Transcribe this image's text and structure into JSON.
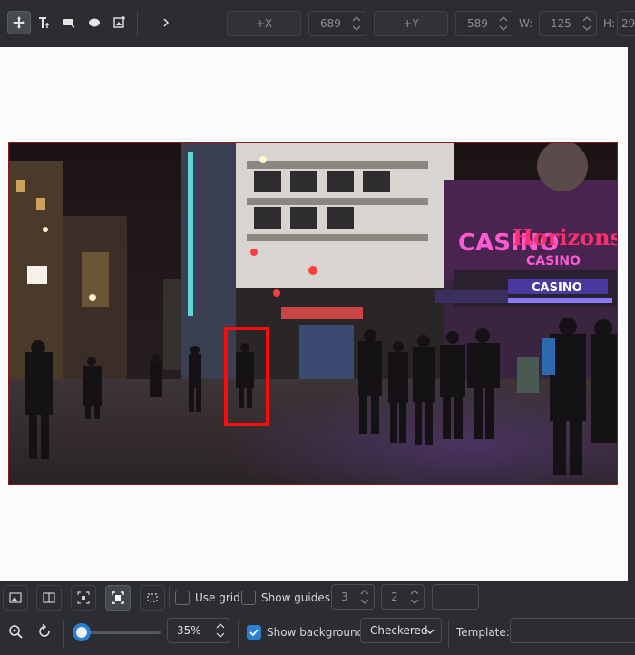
{
  "toolbar": {
    "tools": [
      "move-tool",
      "text-tool",
      "rect-tool",
      "ellipse-tool",
      "image-tool"
    ],
    "more_label": "›",
    "x_button": "+X",
    "x_value": "689",
    "y_button": "+Y",
    "y_value": "589",
    "w_label": "W:",
    "w_value": "125",
    "h_label": "H:",
    "h_value": "29"
  },
  "canvas": {
    "image_kind": "night street photo",
    "selection_color": "#ff0a0a",
    "background": "#fbfbfb"
  },
  "bottom1": {
    "use_grid_label": "Use grid",
    "show_guides_label": "Show guides:",
    "guides_cols": "3",
    "guides_rows": "2"
  },
  "bottom2": {
    "zoom_value": "35%",
    "zoom_level": 0.08,
    "show_background_label": "Show background",
    "background_mode": "Checkered",
    "template_label": "Template:",
    "template_value": ""
  },
  "colors": {
    "accent": "#2b7fd3",
    "bg": "#2b2d31"
  }
}
